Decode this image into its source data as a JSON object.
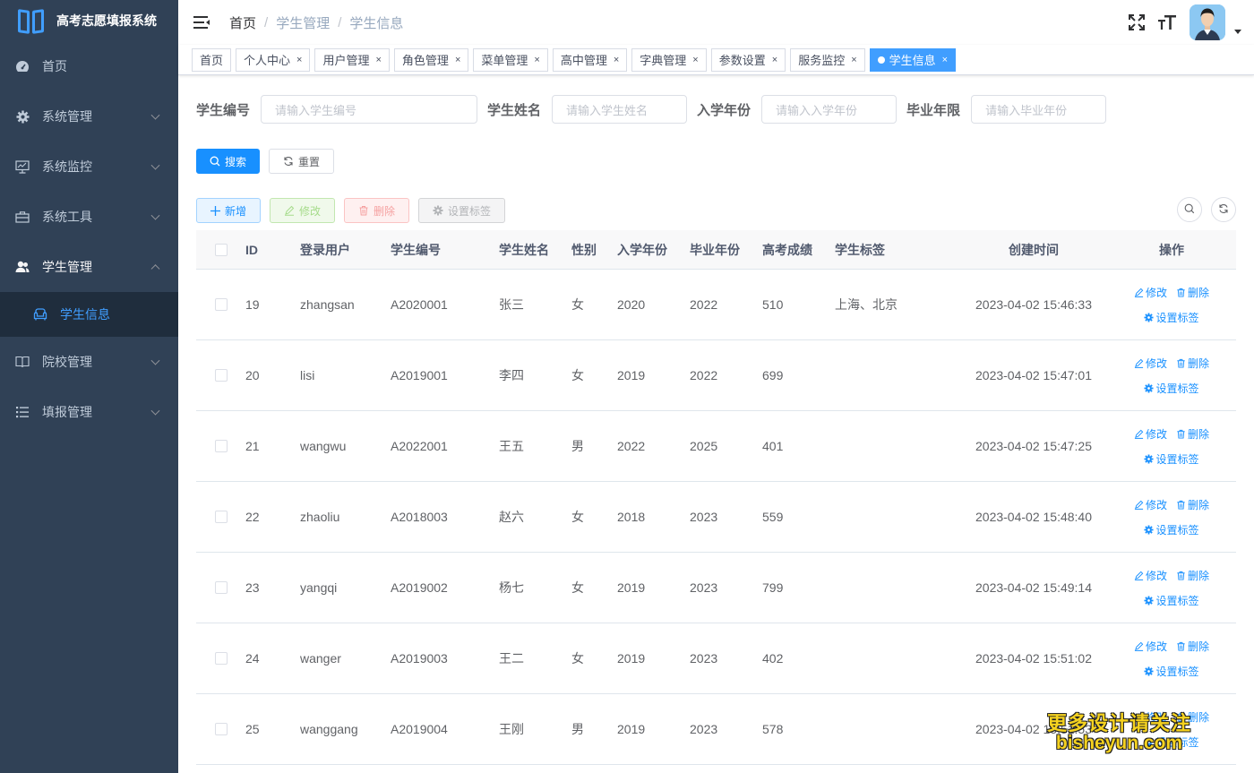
{
  "app": {
    "title": "高考志愿填报系统"
  },
  "sidebar": {
    "items": [
      {
        "label": "首页",
        "icon": "dashboard-icon",
        "has_arrow": false
      },
      {
        "label": "系统管理",
        "icon": "gear-icon",
        "has_arrow": true
      },
      {
        "label": "系统监控",
        "icon": "monitor-icon",
        "has_arrow": true
      },
      {
        "label": "系统工具",
        "icon": "toolbox-icon",
        "has_arrow": true
      },
      {
        "label": "学生管理",
        "icon": "users-icon",
        "has_arrow": true,
        "open": true
      },
      {
        "label": "院校管理",
        "icon": "book-icon",
        "has_arrow": true
      },
      {
        "label": "填报管理",
        "icon": "list-icon",
        "has_arrow": true
      }
    ],
    "submenu": {
      "label": "学生信息",
      "icon": "sofa-icon"
    }
  },
  "breadcrumb": {
    "home": "首页",
    "items": [
      "学生管理",
      "学生信息"
    ],
    "separator": "/"
  },
  "tags": [
    {
      "label": "首页",
      "closable": false
    },
    {
      "label": "个人中心",
      "closable": true
    },
    {
      "label": "用户管理",
      "closable": true
    },
    {
      "label": "角色管理",
      "closable": true
    },
    {
      "label": "菜单管理",
      "closable": true
    },
    {
      "label": "高中管理",
      "closable": true
    },
    {
      "label": "字典管理",
      "closable": true
    },
    {
      "label": "参数设置",
      "closable": true
    },
    {
      "label": "服务监控",
      "closable": true
    },
    {
      "label": "学生信息",
      "closable": true,
      "active": true
    }
  ],
  "tag_close": "×",
  "search": {
    "fields": [
      {
        "label": "学生编号",
        "placeholder": "请输入学生编号"
      },
      {
        "label": "学生姓名",
        "placeholder": "请输入学生姓名"
      },
      {
        "label": "入学年份",
        "placeholder": "请输入入学年份"
      },
      {
        "label": "毕业年限",
        "placeholder": "请输入毕业年份"
      }
    ],
    "search_label": "搜索",
    "reset_label": "重置"
  },
  "toolbar": {
    "add_label": "新增",
    "edit_label": "修改",
    "delete_label": "删除",
    "tag_label": "设置标签"
  },
  "table": {
    "columns": [
      "ID",
      "登录用户",
      "学生编号",
      "学生姓名",
      "性别",
      "入学年份",
      "毕业年份",
      "高考成绩",
      "学生标签",
      "创建时间",
      "操作"
    ],
    "rows": [
      {
        "id": "19",
        "user": "zhangsan",
        "no": "A2020001",
        "name": "张三",
        "sex": "女",
        "in": "2020",
        "out": "2022",
        "score": "510",
        "tag": "上海、北京",
        "time": "2023-04-02 15:46:33"
      },
      {
        "id": "20",
        "user": "lisi",
        "no": "A2019001",
        "name": "李四",
        "sex": "女",
        "in": "2019",
        "out": "2022",
        "score": "699",
        "tag": "",
        "time": "2023-04-02 15:47:01"
      },
      {
        "id": "21",
        "user": "wangwu",
        "no": "A2022001",
        "name": "王五",
        "sex": "男",
        "in": "2022",
        "out": "2025",
        "score": "401",
        "tag": "",
        "time": "2023-04-02 15:47:25"
      },
      {
        "id": "22",
        "user": "zhaoliu",
        "no": "A2018003",
        "name": "赵六",
        "sex": "女",
        "in": "2018",
        "out": "2023",
        "score": "559",
        "tag": "",
        "time": "2023-04-02 15:48:40"
      },
      {
        "id": "23",
        "user": "yangqi",
        "no": "A2019002",
        "name": "杨七",
        "sex": "女",
        "in": "2019",
        "out": "2023",
        "score": "799",
        "tag": "",
        "time": "2023-04-02 15:49:14"
      },
      {
        "id": "24",
        "user": "wanger",
        "no": "A2019003",
        "name": "王二",
        "sex": "女",
        "in": "2019",
        "out": "2023",
        "score": "402",
        "tag": "",
        "time": "2023-04-02 15:51:02"
      },
      {
        "id": "25",
        "user": "wanggang",
        "no": "A2019004",
        "name": "王刚",
        "sex": "男",
        "in": "2019",
        "out": "2023",
        "score": "578",
        "tag": "",
        "time": "2023-04-02 15:51:53"
      }
    ],
    "op_edit": "修改",
    "op_delete": "删除",
    "op_tag": "设置标签"
  },
  "watermark": {
    "line1": "更多设计请关注",
    "line2": "bisheyun.com"
  },
  "colors": {
    "sidebar_bg": "#304156",
    "submenu_bg": "#1f2d3d",
    "primary": "#1890ff",
    "active_menu": "#409eff",
    "watermark": "#f5d21f"
  }
}
